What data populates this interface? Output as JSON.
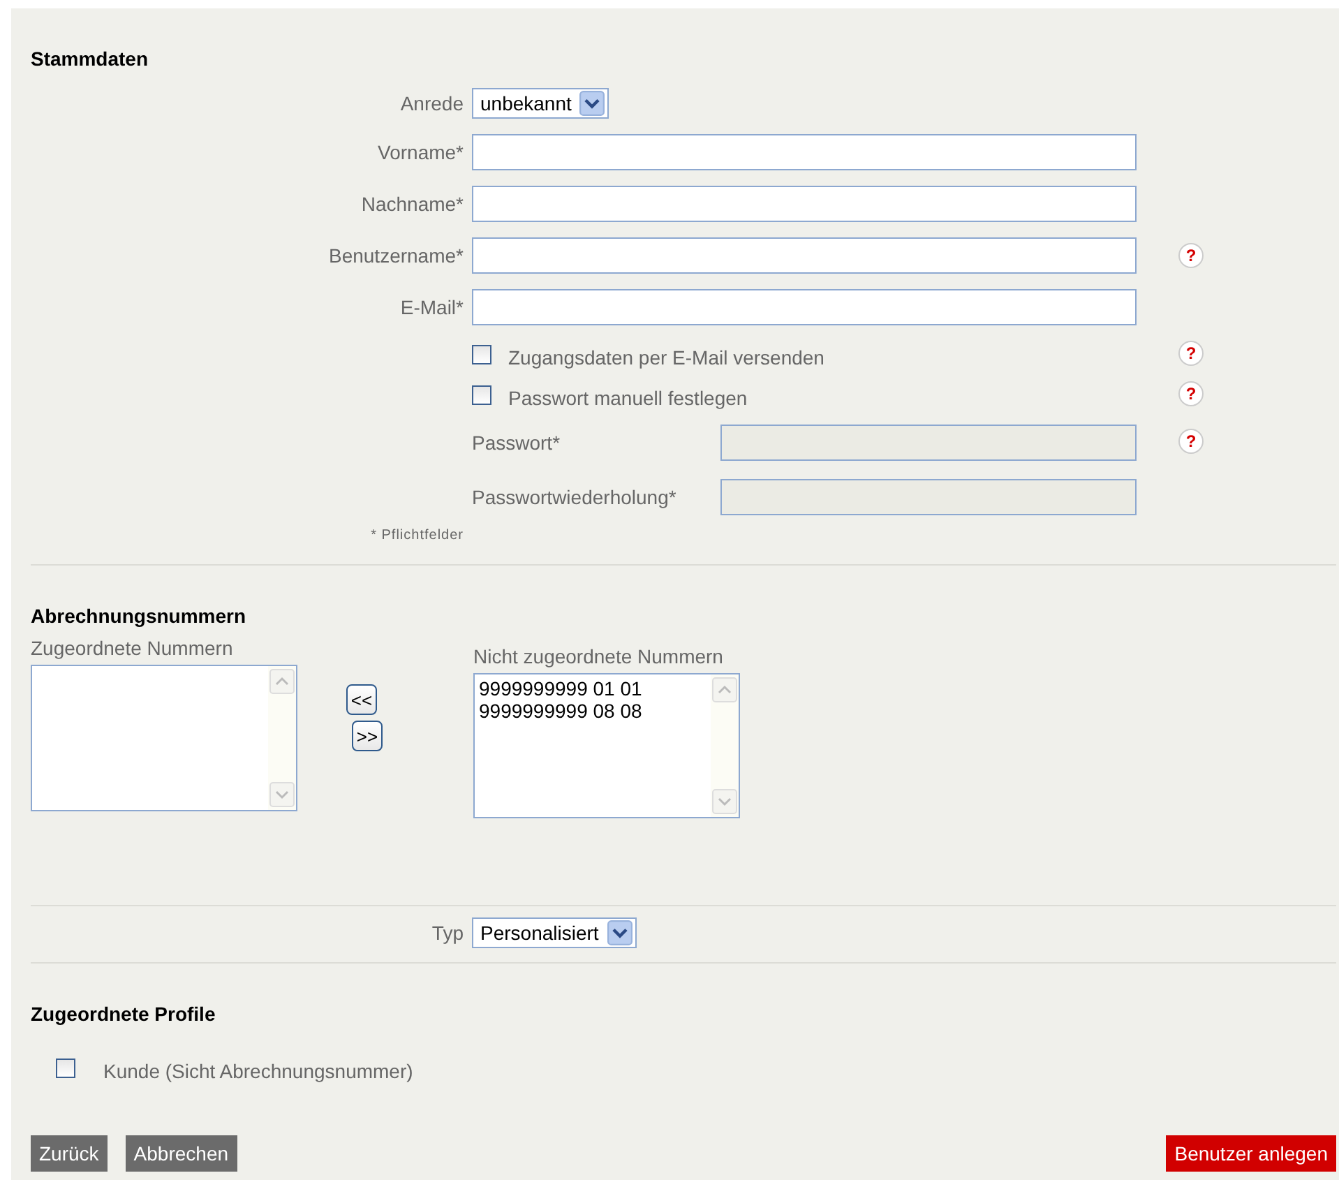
{
  "stammdaten": {
    "title": "Stammdaten",
    "anrede": {
      "label": "Anrede",
      "value": "unbekannt"
    },
    "fields": [
      {
        "label": "Vorname*"
      },
      {
        "label": "Nachname*"
      },
      {
        "label": "Benutzername*",
        "help": "?"
      },
      {
        "label": "E-Mail*"
      }
    ],
    "checkboxes": [
      {
        "label": "Zugangsdaten per E-Mail versenden",
        "checked": false,
        "help": "?"
      },
      {
        "label": "Passwort manuell festlegen",
        "checked": false,
        "help": "?"
      }
    ],
    "password_fields": [
      {
        "label": "Passwort*",
        "disabled": true,
        "help": "?"
      },
      {
        "label": "Passwortwiederholung*",
        "disabled": true
      }
    ],
    "footnote": "* Pflichtfelder"
  },
  "abrechnungsnummern": {
    "title": "Abrechnungsnummern",
    "assigned": {
      "label": "Zugeordnete Nummern"
    },
    "move_left": "<<",
    "move_right": ">>",
    "unassigned": {
      "label": "Nicht zugeordnete Nummern",
      "items": [
        "9999999999 01 01",
        "9999999999 08 08"
      ]
    }
  },
  "typ": {
    "label": "Typ",
    "value": "Personalisiert"
  },
  "profile": {
    "title": "Zugeordnete Profile",
    "items": [
      {
        "label": "Kunde (Sicht Abrechnungsnummer)",
        "checked": false
      }
    ]
  },
  "buttons": [
    {
      "label": "Zurück",
      "kind": "secondary"
    },
    {
      "label": "Abbrechen",
      "kind": "secondary"
    },
    {
      "label": "Benutzer anlegen",
      "kind": "primary"
    }
  ]
}
